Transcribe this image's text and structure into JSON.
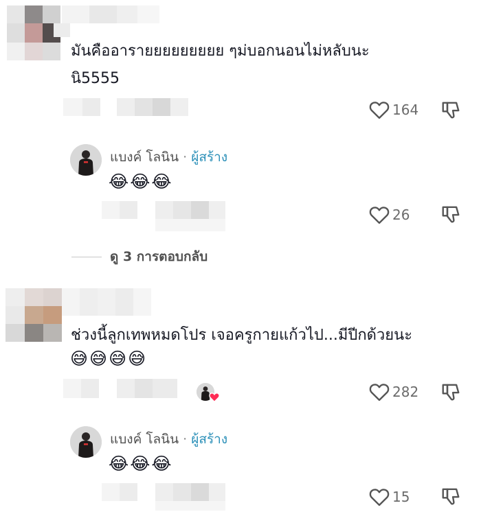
{
  "comments": [
    {
      "text_line1": "มันคืออารายยยยยยยยย ๆม่บอกนอนไม่หลับนะ",
      "text_line2": "นิ5555",
      "likes": "164",
      "reply": {
        "author": "แบงค์ โลนิน",
        "separator": "·",
        "creator_tag": "ผู้สร้าง",
        "emojis": "😂😂😂",
        "likes": "26"
      },
      "view_replies": "ดู 3 การตอบกลับ"
    },
    {
      "text_line1": "ช่วงนี้ลูกเทพหมดโปร เจอครูกายแก้วไป...มีปีกด้วยนะ",
      "text_line2": "😅😅😅😅",
      "likes": "282",
      "reply": {
        "author": "แบงค์ โลนิน",
        "separator": "·",
        "creator_tag": "ผู้สร้าง",
        "emojis": "😂😂😂",
        "likes": "15"
      }
    }
  ],
  "icons": {
    "like": "heart-outline-icon",
    "dislike": "thumbs-down-icon",
    "creator_liked_badge": "heart-badge-icon"
  },
  "colors": {
    "text": "#161823",
    "muted": "#6b6b6b",
    "creator_tag": "#2a8fb8",
    "heart_badge": "#fe2c55"
  }
}
